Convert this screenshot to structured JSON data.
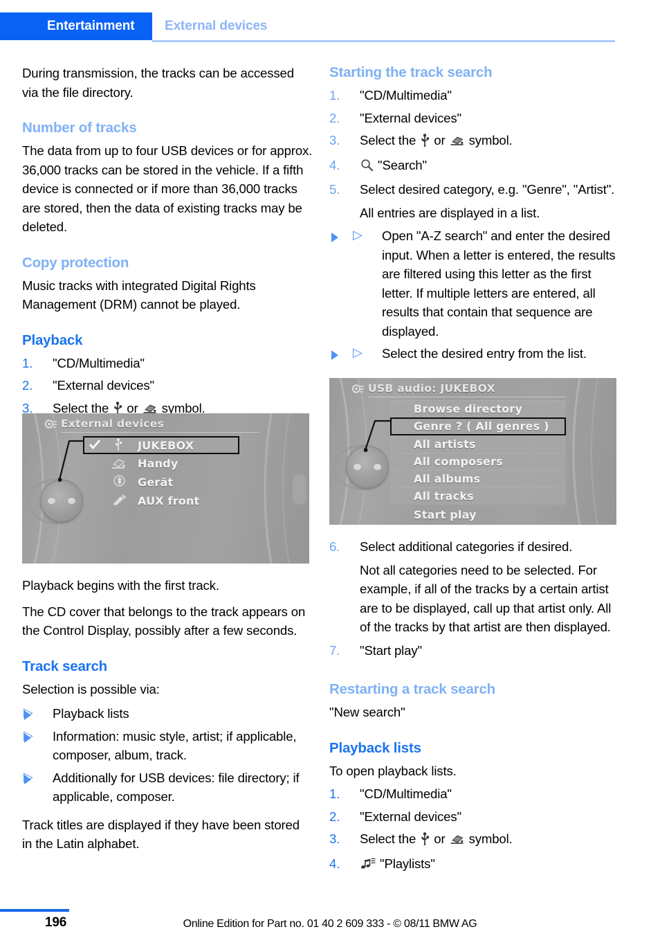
{
  "header": {
    "active_tab": "Entertainment",
    "inactive_tab": "External devices",
    "accent_blue": "#0a62f5",
    "accent_light_blue": "#8cb6f7"
  },
  "left_column": {
    "intro": "During transmission, the tracks can be accessed via the file directory.",
    "number_of_tracks": {
      "heading": "Number of tracks",
      "body": "The data from up to four USB devices or for approx. 36,000 tracks can be stored in the vehicle. If a fifth device is connected or if more than 36,000 tracks are stored, then the data of existing tracks may be deleted."
    },
    "copy_protection": {
      "heading": "Copy protection",
      "body": "Music tracks with integrated Digital Rights Management (DRM) cannot be played."
    },
    "playback": {
      "heading": "Playback",
      "steps": [
        {
          "num": "1.",
          "text": "\"CD/Multimedia\""
        },
        {
          "num": "2.",
          "text": "\"External devices\""
        },
        {
          "num": "3.",
          "text": "Select the"
        },
        {
          "num": "3.",
          "text_mid": "or",
          "text_end": "symbol."
        }
      ],
      "step3_prefix": "Select the",
      "step3_middle": "or",
      "step3_suffix": "symbol."
    },
    "after_image": {
      "line1": "Playback begins with the first track.",
      "line2": "The CD cover that belongs to the track appears on the Control Display, possibly after a few seconds."
    },
    "track_search": {
      "heading": "Track search",
      "intro": "Selection is possible via:",
      "bullets": [
        "Playback lists",
        "Information: music style, artist; if applicable, composer, album, track.",
        "Additionally for USB devices: file directory; if applicable, composer."
      ],
      "outro": "Track titles are displayed if they have been stored in the Latin alphabet."
    }
  },
  "right_column": {
    "starting_track_search": {
      "heading": "Starting the track search",
      "steps": [
        {
          "num": "1.",
          "text": "\"CD/Multimedia\""
        },
        {
          "num": "2.",
          "text": "\"External devices\""
        },
        {
          "num": "4.",
          "text": "\"Search\""
        },
        {
          "num": "5.",
          "text": "Select desired category, e.g. \"Genre\", \"Artist\"."
        }
      ],
      "step3_prefix": "Select the",
      "step3_middle": "or",
      "step3_suffix": "symbol.",
      "sub_note": "All entries are displayed in a list.",
      "bullets": [
        "Open \"A-Z search\" and enter the desired input. When a letter is entered, the results are filtered using this letter as the first letter. If multiple letters are entered, all results that contain that sequence are displayed.",
        "Select the desired entry from the list."
      ],
      "step6": {
        "num": "6.",
        "text": "Select additional categories if desired."
      },
      "step6_note": "Not all categories need to be selected. For example, if all of the tracks by a certain artist are to be displayed, call up that artist only. All of the tracks by that artist are then displayed.",
      "step7": {
        "num": "7.",
        "text": "\"Start play\""
      }
    },
    "restarting": {
      "heading": "Restarting a track search",
      "body": "\"New search\""
    },
    "playback_lists": {
      "heading": "Playback lists",
      "intro": "To open playback lists.",
      "steps": [
        {
          "num": "1.",
          "text": "\"CD/Multimedia\""
        },
        {
          "num": "2.",
          "text": "\"External devices\""
        },
        {
          "num": "4.",
          "text": "\"Playlists\""
        }
      ],
      "step3_prefix": "Select the",
      "step3_middle": "or",
      "step3_suffix": "symbol.",
      "step3_num": "3.",
      "step4_num": "4."
    }
  },
  "screenshot_external_devices": {
    "title": "External devices",
    "rows": [
      {
        "label": "JUKEBOX",
        "icon": "usb-icon",
        "checked": true,
        "highlighted": true
      },
      {
        "label": "Handy",
        "icon": "media-device-icon",
        "checked": false,
        "highlighted": false
      },
      {
        "label": "Gerät",
        "icon": "bluetooth-icon",
        "checked": false,
        "highlighted": false
      },
      {
        "label": "AUX front",
        "icon": "aux-plug-icon",
        "checked": false,
        "highlighted": false
      }
    ]
  },
  "screenshot_usb_audio": {
    "title": "USB audio: JUKEBOX",
    "rows": [
      {
        "label": "Browse directory",
        "highlighted": false
      },
      {
        "label": "Genre ? ( All genres )",
        "highlighted": true
      },
      {
        "label": "All artists",
        "highlighted": false
      },
      {
        "label": "All composers",
        "highlighted": false
      },
      {
        "label": "All albums",
        "highlighted": false
      },
      {
        "label": "All tracks",
        "highlighted": false
      },
      {
        "label": "Start play",
        "highlighted": false
      }
    ]
  },
  "footer": {
    "page_number": "196",
    "notice": "Online Edition for Part no. 01 40 2 609 333 - © 08/11 BMW AG"
  }
}
